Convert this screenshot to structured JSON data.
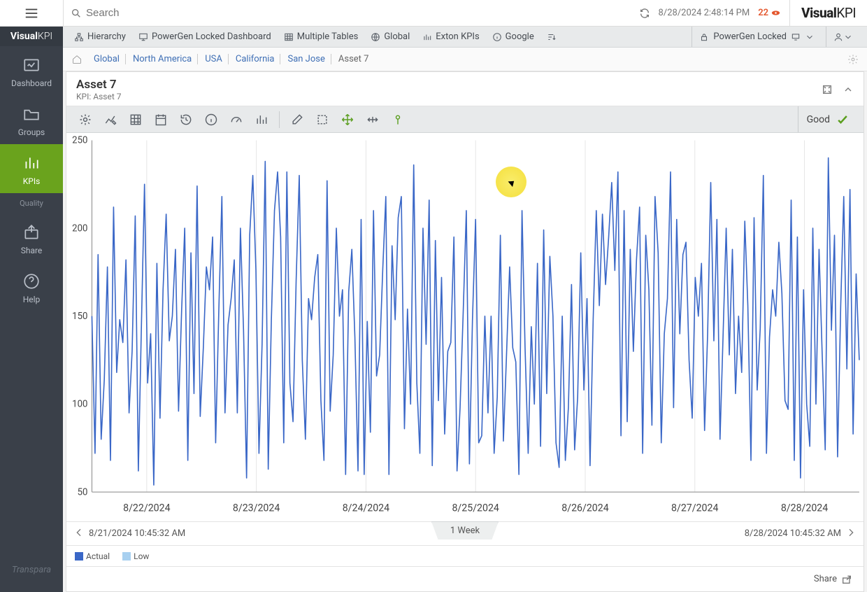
{
  "top": {
    "search_placeholder": "Search",
    "timestamp": "8/28/2024 2:48:14 PM",
    "alert_count": "22",
    "brand_bold": "Visual",
    "brand_thin": "KPI"
  },
  "sidebar": {
    "logo_bold": "Visual",
    "logo_thin": "KPI",
    "items": [
      {
        "label": "Dashboard"
      },
      {
        "label": "Groups"
      },
      {
        "label": "KPIs"
      },
      {
        "label": "Quality"
      },
      {
        "label": "Share"
      },
      {
        "label": "Help"
      }
    ],
    "footer": "Transpara"
  },
  "ribbon": {
    "items": [
      {
        "label": "Hierarchy"
      },
      {
        "label": "PowerGen Locked Dashboard"
      },
      {
        "label": "Multiple Tables"
      },
      {
        "label": "Global"
      },
      {
        "label": "Exton KPIs"
      },
      {
        "label": "Google"
      }
    ],
    "locked_label": "PowerGen Locked"
  },
  "breadcrumbs": [
    "Global",
    "North America",
    "USA",
    "California",
    "San Jose",
    "Asset 7"
  ],
  "panel": {
    "title": "Asset 7",
    "subtitle": "KPI: Asset 7",
    "status": "Good"
  },
  "range": {
    "start": "8/21/2024 10:45:32 AM",
    "end": "8/28/2024 10:45:32 AM",
    "label": "1 Week"
  },
  "legend": [
    {
      "label": "Actual",
      "color": "#3a67c7"
    },
    {
      "label": "Low",
      "color": "#a8d0f0"
    }
  ],
  "share_label": "Share",
  "chart_data": {
    "type": "line",
    "xlabel": "",
    "ylabel": "",
    "ylim": [
      50,
      250
    ],
    "x_ticks": [
      "8/22/2024",
      "8/23/2024",
      "8/24/2024",
      "8/25/2024",
      "8/26/2024",
      "8/27/2024",
      "8/28/2024"
    ],
    "y_ticks": [
      50,
      100,
      150,
      200,
      250
    ],
    "series": [
      {
        "name": "Actual",
        "color": "#3a67c7",
        "values": [
          150,
          72,
          185,
          80,
          114,
          178,
          68,
          212,
          118,
          148,
          135,
          182,
          95,
          130,
          207,
          62,
          144,
          225,
          112,
          140,
          54,
          180,
          92,
          165,
          208,
          136,
          150,
          188,
          96,
          154,
          200,
          68,
          186,
          106,
          224,
          93,
          132,
          178,
          165,
          195,
          78,
          152,
          218,
          95,
          145,
          160,
          182,
          95,
          200,
          142,
          58,
          196,
          230,
          176,
          72,
          134,
          238,
          63,
          148,
          210,
          232,
          195,
          78,
          232,
          112,
          90,
          170,
          230,
          125,
          80,
          160,
          148,
          172,
          185,
          102,
          68,
          227,
          96,
          128,
          200,
          150,
          165,
          60,
          164,
          188,
          138,
          62,
          205,
          60,
          147,
          84,
          210,
          116,
          128,
          177,
          218,
          60,
          190,
          148,
          206,
          218,
          86,
          154,
          100,
          236,
          112,
          72,
          200,
          134,
          216,
          65,
          193,
          102,
          172,
          83,
          130,
          135,
          195,
          62,
          98,
          152,
          210,
          66,
          148,
          205,
          78,
          82,
          150,
          95,
          150,
          72,
          104,
          196,
          79,
          128,
          178,
          132,
          124,
          60,
          210,
          132,
          72,
          144,
          100,
          180,
          76,
          199,
          106,
          184,
          150,
          78,
          64,
          150,
          68,
          98,
          168,
          74,
          104,
          186,
          108,
          160,
          65,
          148,
          210,
          156,
          208,
          168,
          195,
          226,
          176,
          232,
          82,
          210,
          90,
          188,
          130,
          182,
          212,
          72,
          196,
          165,
          88,
          218,
          186,
          78,
          140,
          160,
          232,
          98,
          205,
          140,
          185,
          192,
          125,
          92,
          172,
          150,
          180,
          85,
          140,
          226,
          136,
          205,
          80,
          140,
          200,
          128,
          188,
          106,
          150,
          118,
          204,
          156,
          68,
          206,
          108,
          143,
          230,
          72,
          138,
          165,
          150,
          192,
          163,
          102,
          97,
          216,
          68,
          195,
          58,
          165,
          100,
          76,
          200,
          100,
          188,
          130,
          74,
          240,
          142,
          196,
          70,
          156,
          218,
          120,
          222,
          83,
          174,
          125
        ]
      }
    ]
  }
}
